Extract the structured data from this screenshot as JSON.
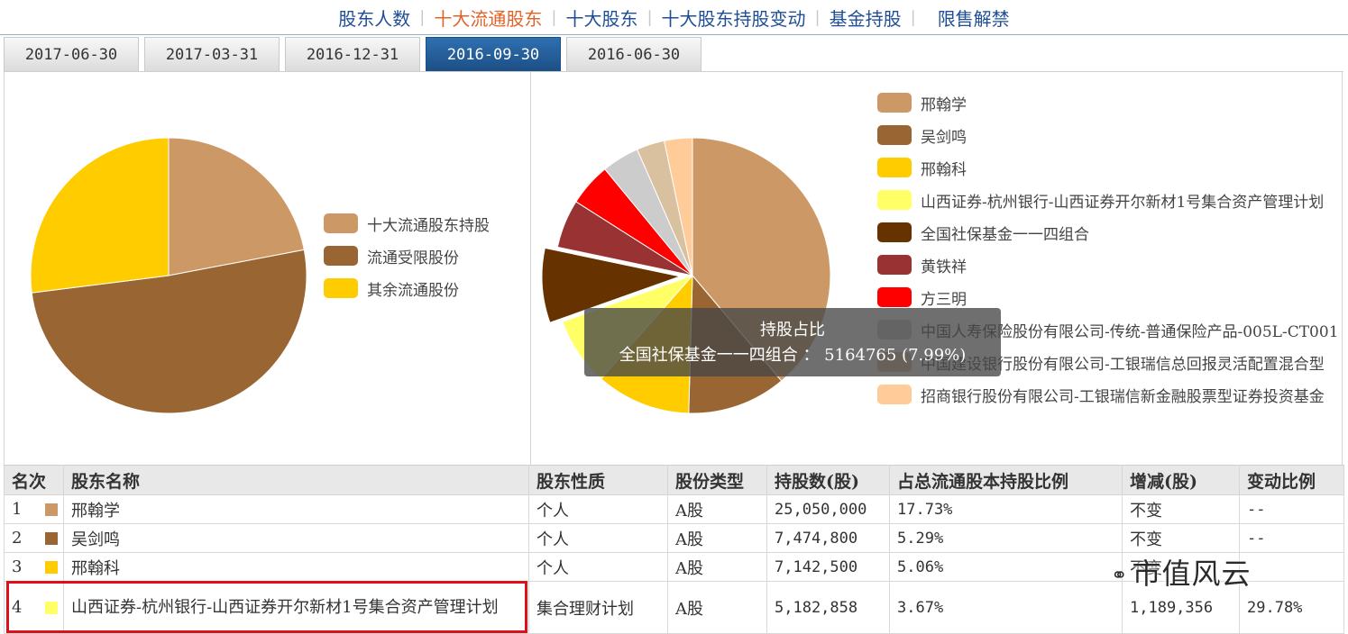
{
  "nav": {
    "items": [
      "股东人数",
      "十大流通股东",
      "十大股东",
      "十大股东持股变动",
      "基金持股",
      "限售解禁"
    ],
    "active_index": 1
  },
  "date_tabs": [
    "2017-06-30",
    "2017-03-31",
    "2016-12-31",
    "2016-09-30",
    "2016-06-30"
  ],
  "active_tab_index": 3,
  "chart_data": [
    {
      "type": "pie",
      "title": "",
      "labels": [
        "十大流通股东持股",
        "流通受限股份",
        "其余流通股份"
      ],
      "values": [
        22,
        51,
        27
      ],
      "colors": [
        "#cc9966",
        "#996633",
        "#ffcc00"
      ],
      "legend_position": "right"
    },
    {
      "type": "pie",
      "title": "",
      "labels": [
        "邢翰学",
        "吴剑鸣",
        "邢翰科",
        "山西证券-杭州银行-山西证券开尔新材1号集合资产管理计划",
        "全国社保基金一一四组合",
        "黄铁祥",
        "方三明",
        "中国人寿保险股份有限公司-传统-普通保险产品-005L-CT001",
        "中国建设银行股份有限公司-工银瑞信总回报灵活配置混合型",
        "招商银行股份有限公司-工银瑞信新金融股票型证券投资基金"
      ],
      "values": [
        35.46,
        10.58,
        10.11,
        7.34,
        7.99,
        5.2,
        4.6,
        4.0,
        3.0,
        3.0
      ],
      "colors": [
        "#cc9966",
        "#996633",
        "#ffcc00",
        "#ffff66",
        "#663300",
        "#993333",
        "#ff0000",
        "#cccccc",
        "#d9c19f",
        "#ffcc99"
      ],
      "legend_position": "right",
      "exploded_index": 4
    }
  ],
  "tooltip": {
    "title": "持股占比",
    "text": "全国社保基金一一四组合 ： 5164765 (7.99%)"
  },
  "table": {
    "headers": [
      "名次",
      "股东名称",
      "股东性质",
      "股份类型",
      "持股数(股)",
      "占总流通股本持股比例",
      "增减(股)",
      "变动比例"
    ],
    "rows": [
      {
        "rank": "1",
        "color": "#cc9966",
        "name": "邢翰学",
        "nature": "个人",
        "type": "A股",
        "shares": "25,050,000",
        "ratio": "17.73%",
        "change": "不变",
        "change_pct": "--"
      },
      {
        "rank": "2",
        "color": "#996633",
        "name": "吴剑鸣",
        "nature": "个人",
        "type": "A股",
        "shares": "7,474,800",
        "ratio": "5.29%",
        "change": "不变",
        "change_pct": "--"
      },
      {
        "rank": "3",
        "color": "#ffcc00",
        "name": "邢翰科",
        "nature": "个人",
        "type": "A股",
        "shares": "7,142,500",
        "ratio": "5.06%",
        "change": "不变",
        "change_pct": ""
      },
      {
        "rank": "4",
        "color": "#ffff66",
        "name": "山西证券-杭州银行-山西证券开尔新材1号集合资产管理计划",
        "nature": "集合理财计划",
        "type": "A股",
        "shares": "5,182,858",
        "ratio": "3.67%",
        "change": "1,189,356",
        "change_pct": "29.78%"
      }
    ]
  },
  "watermark": "市值风云"
}
